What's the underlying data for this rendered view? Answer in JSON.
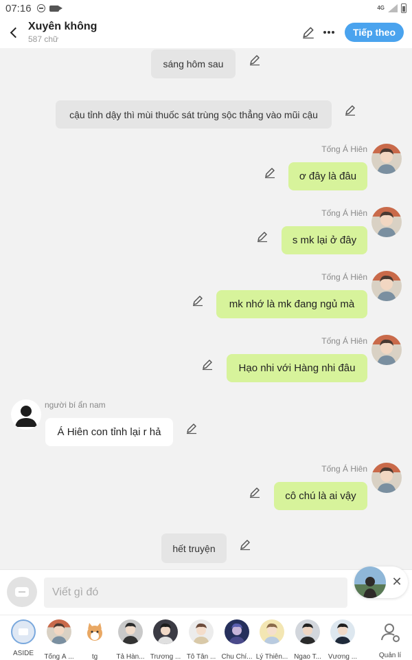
{
  "status_bar": {
    "time": "07:16",
    "network": "4G"
  },
  "header": {
    "title": "Xuyên không",
    "word_count": "587 chữ",
    "next_label": "Tiếp theo"
  },
  "messages": [
    {
      "type": "narration",
      "text": "sáng hôm sau"
    },
    {
      "type": "narration",
      "text": "cậu tỉnh dậy thì mùi thuốc sát trùng sộc thẳng vào mũi cậu"
    },
    {
      "type": "right",
      "speaker": "Tống Á Hiên",
      "text": "ơ đây là đâu"
    },
    {
      "type": "right",
      "speaker": "Tống Á Hiên",
      "text": "s mk lại ở đây"
    },
    {
      "type": "right",
      "speaker": "Tống Á Hiên",
      "text": "mk nhớ là mk đang ngủ mà"
    },
    {
      "type": "right",
      "speaker": "Tống Á Hiên",
      "text": "Hạo nhi với Hàng nhi đâu"
    },
    {
      "type": "left",
      "speaker": "người bí ẩn nam",
      "text": "Á Hiên con tỉnh lại r hả"
    },
    {
      "type": "right",
      "speaker": "Tống Á Hiên",
      "text": "cô chú là ai vậy"
    },
    {
      "type": "narration",
      "text": "hết truyện"
    }
  ],
  "composer": {
    "placeholder": "Viết gì đó"
  },
  "characters": [
    {
      "name": "ASIDE"
    },
    {
      "name": "Tống Á ..."
    },
    {
      "name": "tg"
    },
    {
      "name": "Tả Hàn..."
    },
    {
      "name": "Trương ..."
    },
    {
      "name": "Tô Tân ..."
    },
    {
      "name": "Chu Chí..."
    },
    {
      "name": "Lý Thiên..."
    },
    {
      "name": "Ngao T..."
    },
    {
      "name": "Vương ..."
    }
  ],
  "manage_label": "Quản lí",
  "colors": {
    "accent": "#4aa3ee",
    "bubble_right": "#d7f39b",
    "narration_bg": "#e5e5e5"
  },
  "icons": [
    "back-icon",
    "edit-icon",
    "more-icon",
    "close-icon",
    "user-gear-icon"
  ]
}
